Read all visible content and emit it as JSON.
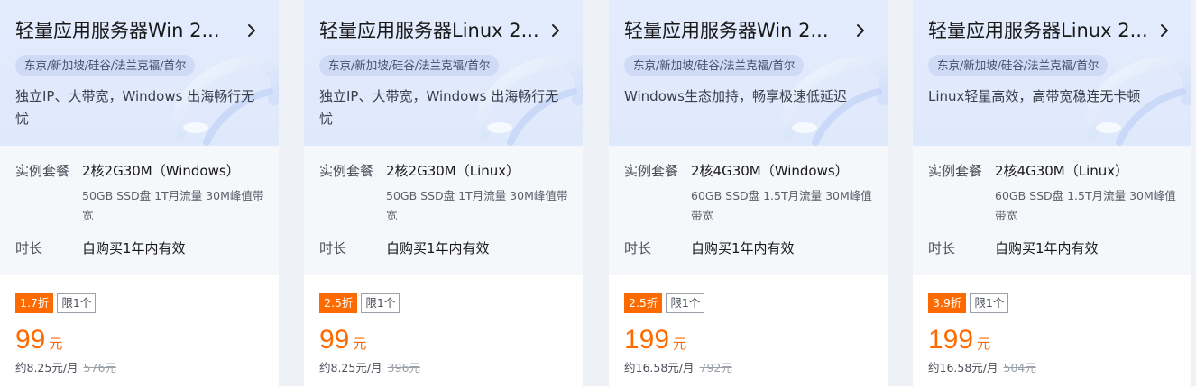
{
  "cards": [
    {
      "title": "轻量应用服务器Win 2...",
      "chevron_icon": "chevron-right-icon",
      "region": "东京/新加坡/硅谷/法兰克福/首尔",
      "description": "独立IP、大带宽，Windows 出海畅行无忧",
      "spec_label": "实例套餐",
      "spec_value": "2核2G30M（Windows）",
      "spec_detail": "50GB SSD盘 1T月流量 30M峰值带宽",
      "duration_label": "时长",
      "duration_value": "自购买1年内有效",
      "discount": "1.7折",
      "limit": "限1个",
      "price": "99",
      "price_unit": "元",
      "monthly": "约8.25元/月",
      "original_price": "576元"
    },
    {
      "title": "轻量应用服务器Linux 2...",
      "chevron_icon": "chevron-right-icon",
      "region": "东京/新加坡/硅谷/法兰克福/首尔",
      "description": "独立IP、大带宽，Windows 出海畅行无忧",
      "spec_label": "实例套餐",
      "spec_value": "2核2G30M（Linux）",
      "spec_detail": "50GB SSD盘 1T月流量 30M峰值带宽",
      "duration_label": "时长",
      "duration_value": "自购买1年内有效",
      "discount": "2.5折",
      "limit": "限1个",
      "price": "99",
      "price_unit": "元",
      "monthly": "约8.25元/月",
      "original_price": "396元"
    },
    {
      "title": "轻量应用服务器Win 2...",
      "chevron_icon": "chevron-right-icon",
      "region": "东京/新加坡/硅谷/法兰克福/首尔",
      "description": "Windows生态加持，畅享极速低延迟",
      "spec_label": "实例套餐",
      "spec_value": "2核4G30M（Windows）",
      "spec_detail": "60GB SSD盘 1.5T月流量 30M峰值带宽",
      "duration_label": "时长",
      "duration_value": "自购买1年内有效",
      "discount": "2.5折",
      "limit": "限1个",
      "price": "199",
      "price_unit": "元",
      "monthly": "约16.58元/月",
      "original_price": "792元"
    },
    {
      "title": "轻量应用服务器Linux 2...",
      "chevron_icon": "chevron-right-icon",
      "region": "东京/新加坡/硅谷/法兰克福/首尔",
      "description": "Linux轻量高效，高带宽稳连无卡顿",
      "spec_label": "实例套餐",
      "spec_value": "2核4G30M（Linux）",
      "spec_detail": "60GB SSD盘 1.5T月流量 30M峰值带宽",
      "duration_label": "时长",
      "duration_value": "自购买1年内有效",
      "discount": "3.9折",
      "limit": "限1个",
      "price": "199",
      "price_unit": "元",
      "monthly": "约16.58元/月",
      "original_price": "504元"
    }
  ],
  "colors": {
    "accent_orange": "#ff6a00",
    "header_bg": "#e3ecfd",
    "spec_bg": "#f5f7fb",
    "region_tag_bg": "#cfdaf7"
  }
}
